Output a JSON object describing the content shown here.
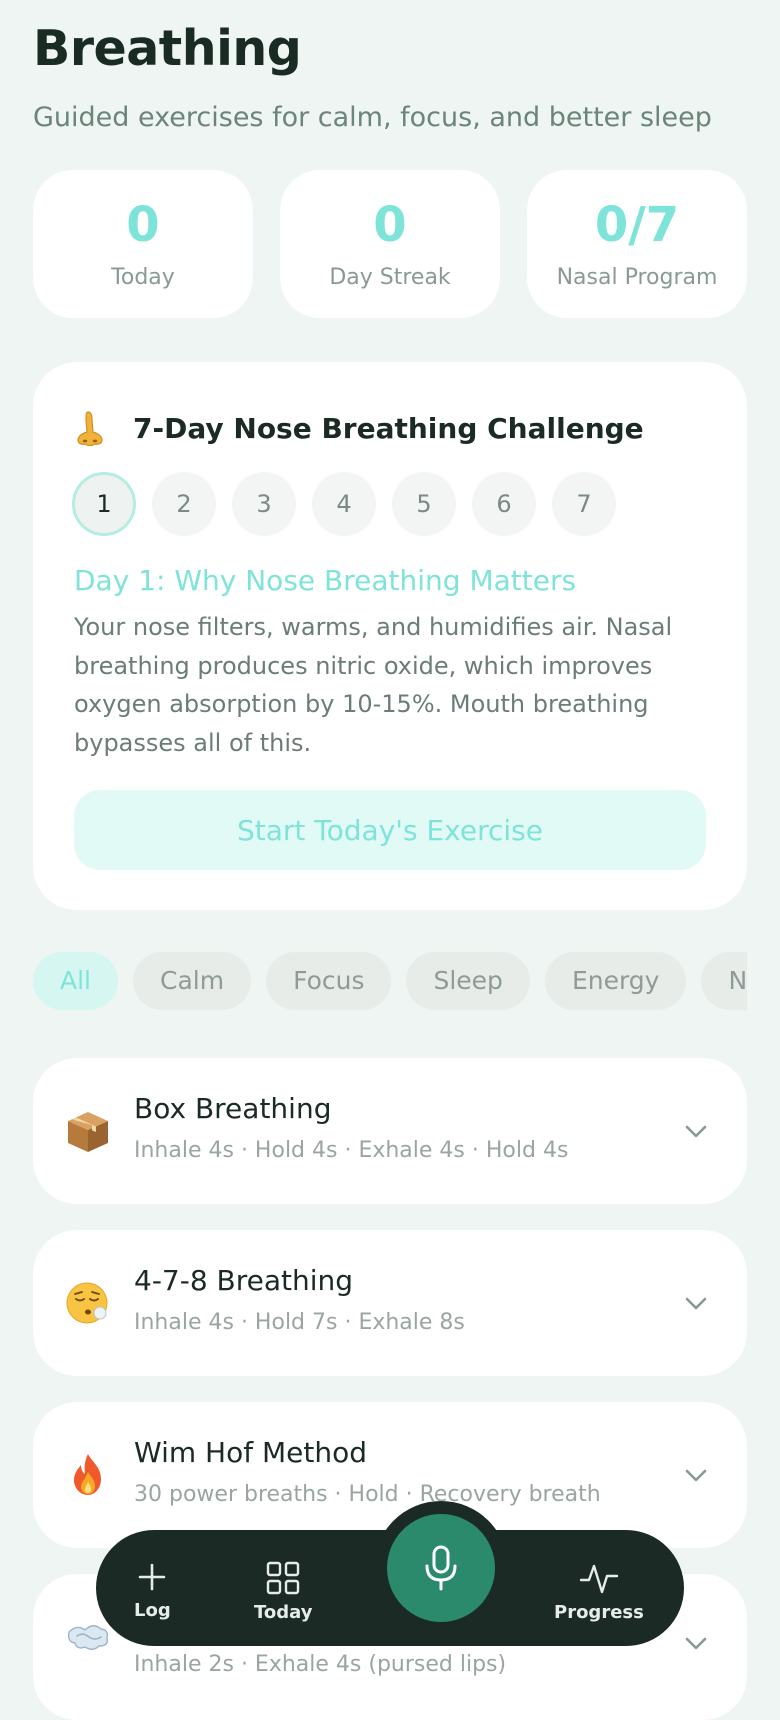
{
  "header": {
    "title": "Breathing",
    "subtitle": "Guided exercises for calm, focus, and better sleep"
  },
  "stats": [
    {
      "value": "0",
      "label": "Today"
    },
    {
      "value": "0",
      "label": "Day Streak"
    },
    {
      "value": "0/7",
      "label": "Nasal Program"
    }
  ],
  "challenge": {
    "icon": "nose-icon",
    "title": "7-Day Nose Breathing Challenge",
    "days": [
      "1",
      "2",
      "3",
      "4",
      "5",
      "6",
      "7"
    ],
    "active_day": "1",
    "day_title": "Day 1: Why Nose Breathing Matters",
    "description": "Your nose filters, warms, and humidifies air. Nasal breathing produces nitric oxide, which improves oxygen absorption by 10-15%. Mouth breathing bypasses all of this.",
    "button_label": "Start Today's Exercise"
  },
  "filters": [
    "All",
    "Calm",
    "Focus",
    "Sleep",
    "Energy",
    "Na"
  ],
  "active_filter": "All",
  "exercises": [
    {
      "icon": "package-icon",
      "title": "Box Breathing",
      "subtitle": "Inhale 4s · Hold 4s · Exhale 4s · Hold 4s"
    },
    {
      "icon": "sleepy-face-icon",
      "title": "4-7-8 Breathing",
      "subtitle": "Inhale 4s · Hold 7s · Exhale 8s"
    },
    {
      "icon": "fire-icon",
      "title": "Wim Hof Method",
      "subtitle": "30 power breaths · Hold · Recovery breath"
    },
    {
      "icon": "wind-icon",
      "title": "",
      "subtitle": "Inhale 2s · Exhale 4s (pursed lips)"
    }
  ],
  "nav": {
    "log": "Log",
    "today": "Today",
    "progress": "Progress"
  },
  "colors": {
    "accent": "#7ee3d8",
    "nav_bg": "#1c2a25",
    "mic": "#2b8a6b",
    "page_bg": "#eff5f2"
  }
}
